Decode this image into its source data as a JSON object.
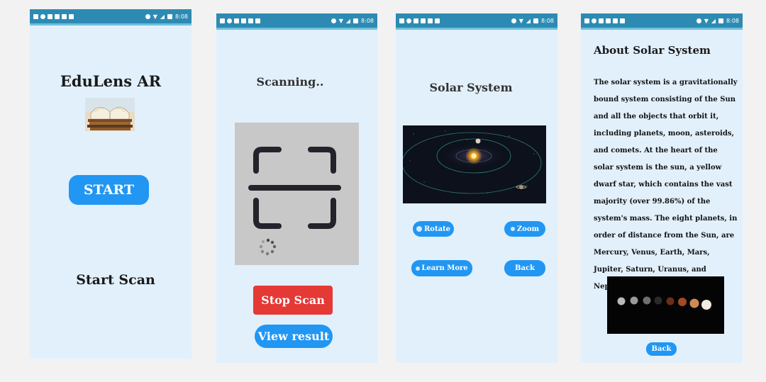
{
  "status_bar": {
    "time": "8:08"
  },
  "screen1": {
    "title": "EduLens AR",
    "start_label": "START",
    "start_scan_label": "Start Scan"
  },
  "screen2": {
    "title": "Scanning..",
    "stop_label": "Stop Scan",
    "view_label": "View result"
  },
  "screen3": {
    "title": "Solar System",
    "rotate_label": "Rotate",
    "zoom_label": "Zoom",
    "learn_label": "Learn More",
    "back_label": "Back"
  },
  "screen4": {
    "title": "About Solar System",
    "description": "The solar system is a gravitationally bound system consisting of the Sun and all the objects that orbit it, including planets, moon, asteroids, and comets. At the heart of the solar system is the sun, a yellow dwarf star, which contains the vast majority (over 99.86%) of the system's mass. The eight planets, in order of distance from the Sun, are Mercury, Venus, Earth, Mars, Jupiter, Saturn, Uranus, and Neptune.",
    "back_label": "Back"
  },
  "colors": {
    "status_bar": "#2d8bb3",
    "screen_bg": "#e2f0fb",
    "primary": "#2196f3",
    "stop": "#e53935"
  }
}
